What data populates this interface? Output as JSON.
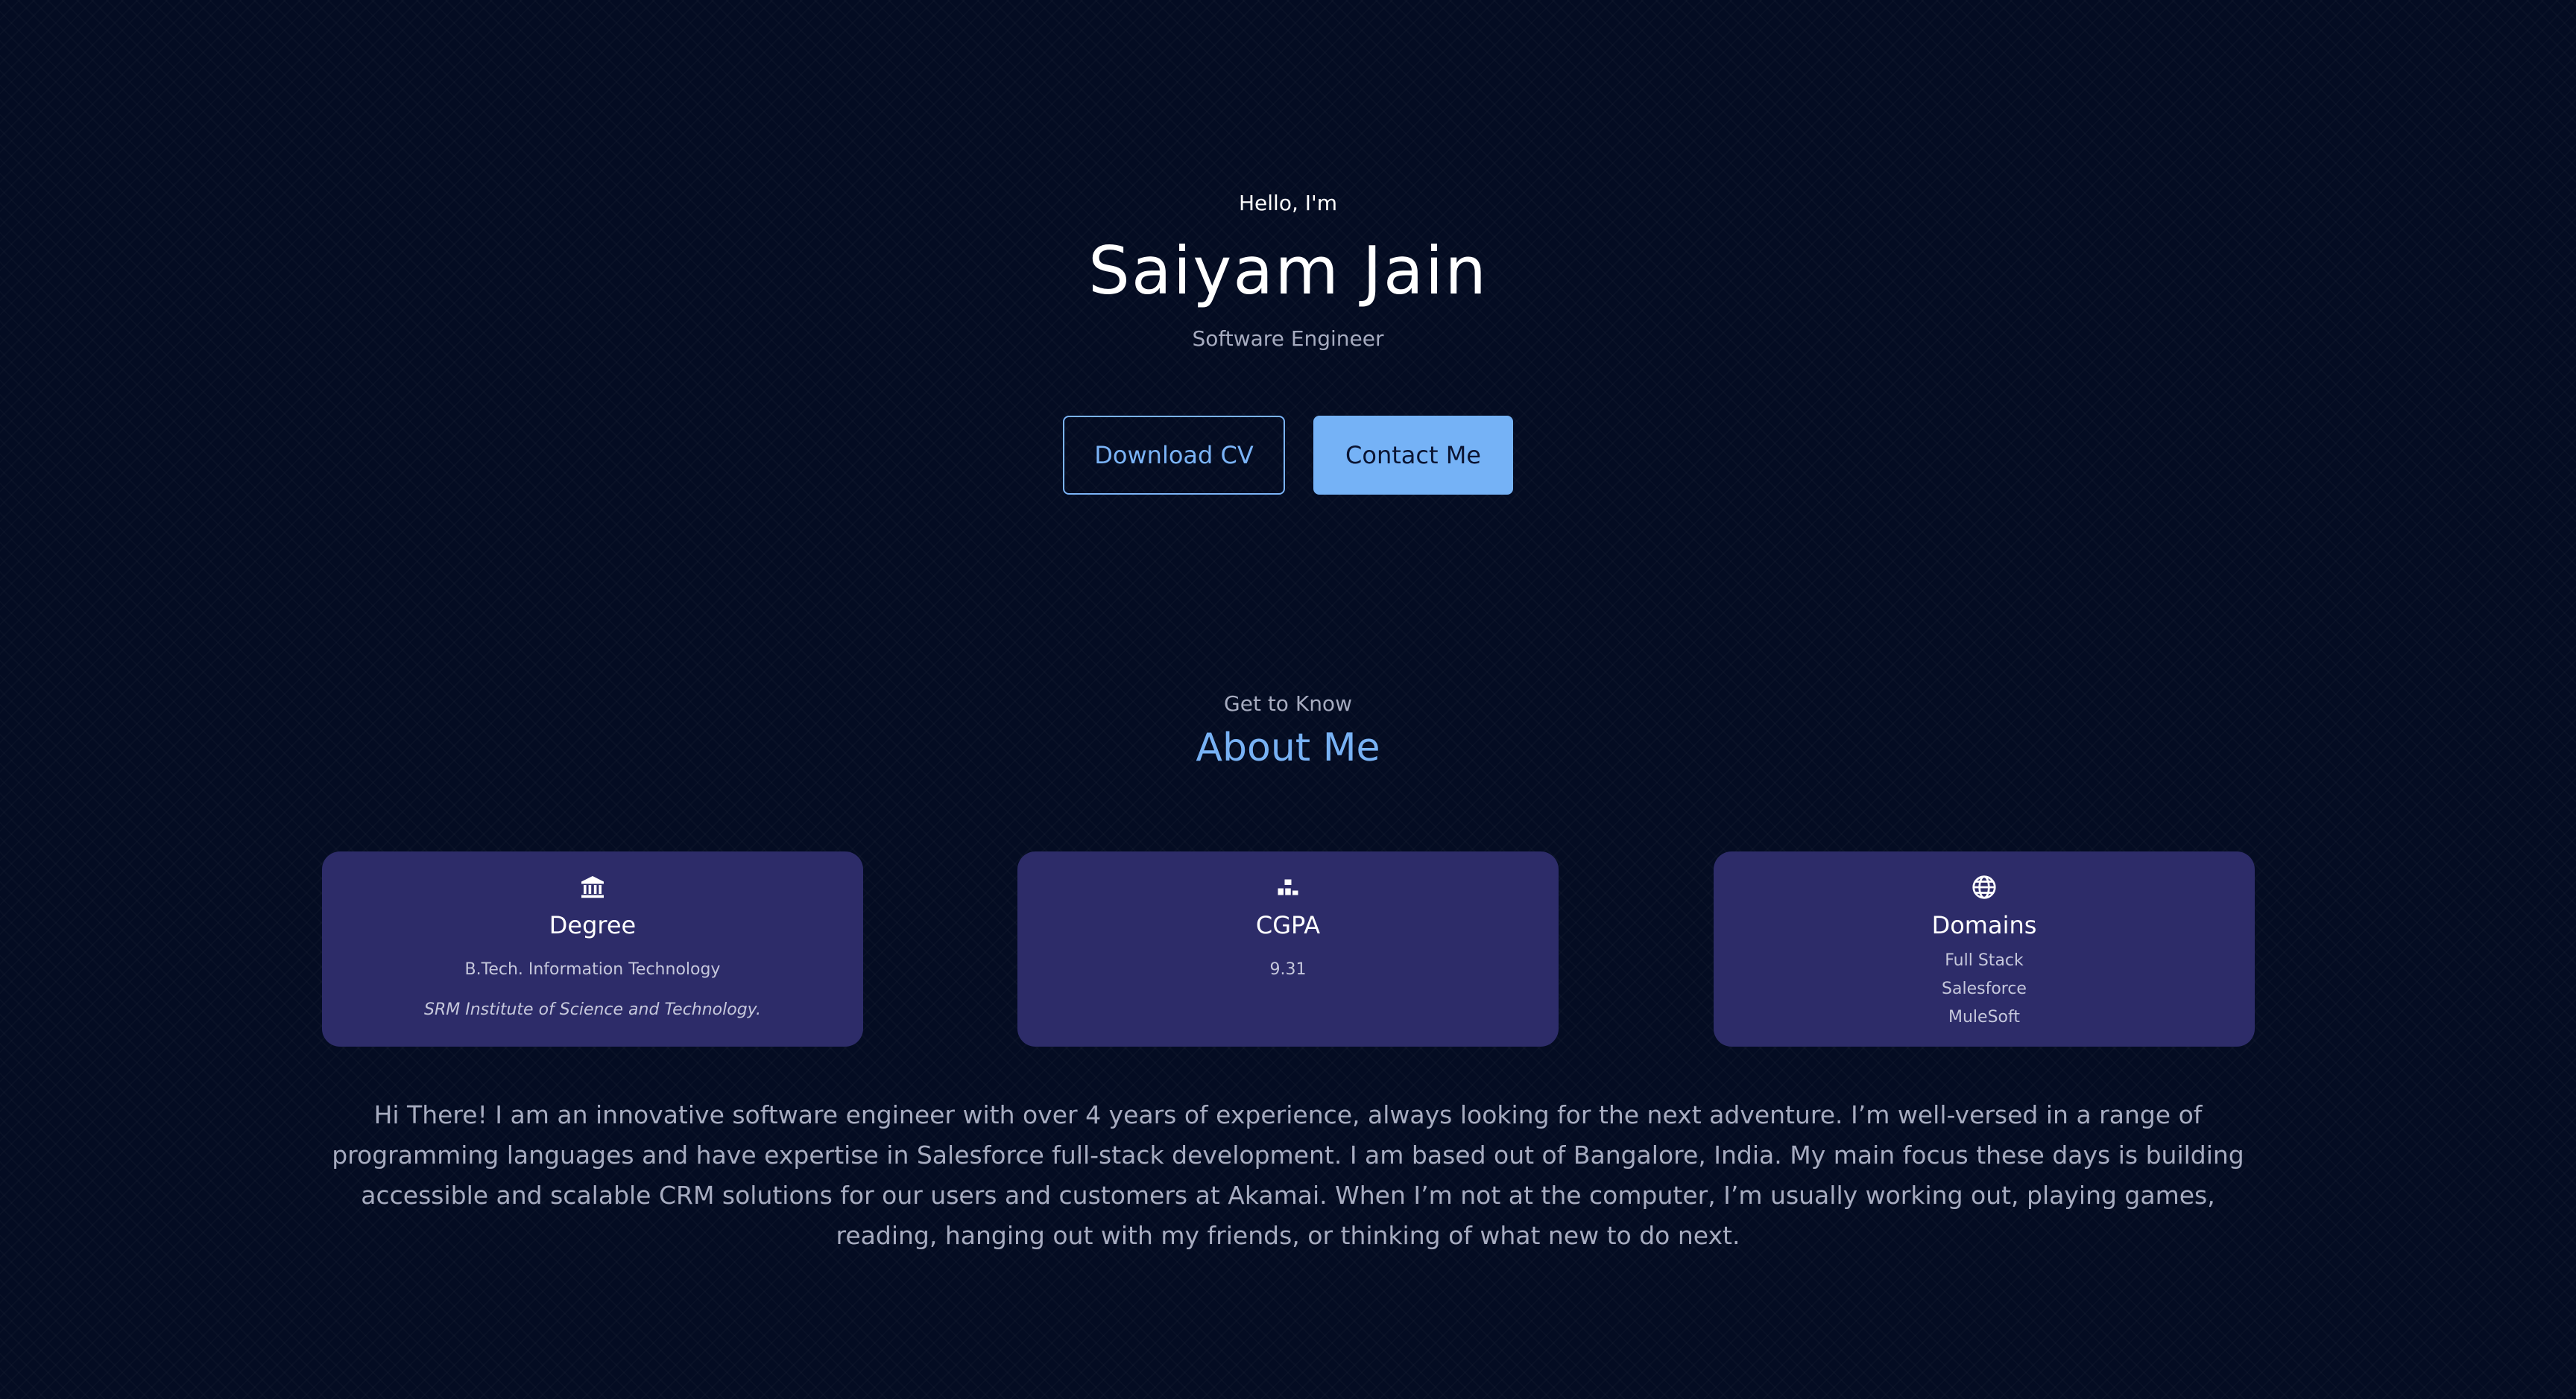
{
  "hero": {
    "greeting": "Hello, I'm",
    "name": "Saiyam Jain",
    "role": "Software Engineer",
    "download_cv_label": "Download CV",
    "contact_label": "Contact Me"
  },
  "about": {
    "eyebrow": "Get to Know",
    "title": "About Me",
    "cards": [
      {
        "icon": "institution-icon",
        "title": "Degree",
        "lines": [
          "B.Tech. Information Technology",
          "SRM Institute of Science and Technology."
        ]
      },
      {
        "icon": "podium-icon",
        "title": "CGPA",
        "lines": [
          "9.31"
        ]
      },
      {
        "icon": "globe-icon",
        "title": "Domains",
        "lines": [
          "Full Stack",
          "Salesforce",
          "MuleSoft"
        ]
      }
    ],
    "bio": "Hi There! I am an innovative software engineer with over 4 years of experience, always looking for the next adventure. I’m well-versed in a range of programming languages and have expertise in Salesforce full-stack development. I am based out of Bangalore, India. My main focus these days is building accessible and scalable CRM solutions for our users and customers at Akamai. When I’m not at the computer, I’m usually working out, playing games, reading, hanging out with my friends, or thinking of what new to do next."
  },
  "colors": {
    "background": "#040c22",
    "accent": "#78b2f5",
    "card": "#2d2c69",
    "muted_text": "#a7acc0"
  }
}
